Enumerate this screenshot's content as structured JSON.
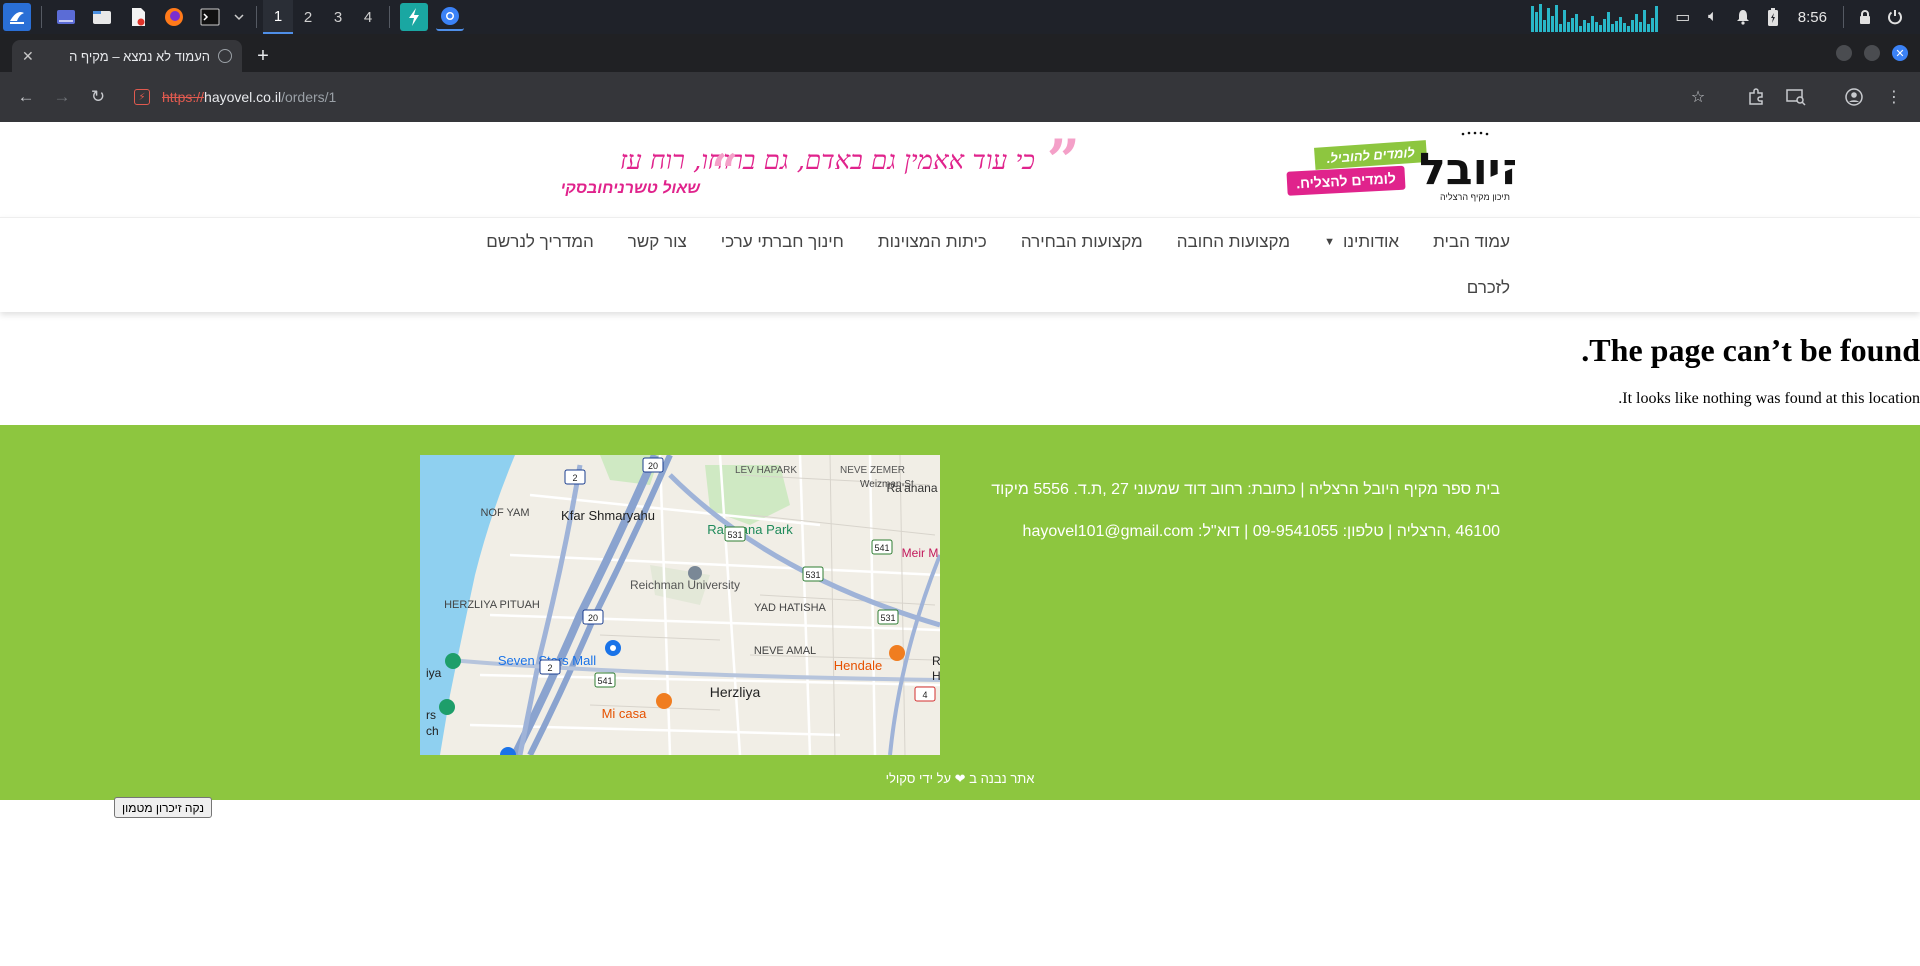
{
  "taskbar": {
    "workspaces": [
      "1",
      "2",
      "3",
      "4"
    ],
    "active_workspace": "1",
    "clock": "8:56",
    "app_icons": [
      "start-menu-icon",
      "desktop-icon",
      "file-manager-icon",
      "text-editor-icon",
      "firefox-icon",
      "terminal-icon",
      "chevron-down-icon",
      "thunder-app-icon",
      "chromium-icon"
    ],
    "tray_icons": [
      "screen-icon",
      "volume-icon",
      "bell-icon",
      "battery-icon",
      "lock-icon"
    ],
    "accent_color": "#4f8fe8"
  },
  "browser": {
    "tab_title": "העמוד לא נמצא – מקיף ה",
    "url_scheme": "https://",
    "url_host": "hayovel.co.il",
    "url_path": "/orders/1"
  },
  "site": {
    "logo_text": "היובל",
    "logo_subtitle": "תיכון מקיף הרצליה",
    "sticker_top": "לומדים להוביל.",
    "sticker_bottom": "לומדים להצליח.",
    "quote": "כי עוד אאמין גם באדם, גם ברוחו, רוח עז",
    "quote_author": "שאול טשרניחובסקי",
    "brand_pink": "#e0238c",
    "brand_green": "#8dc63f"
  },
  "nav": {
    "row1": [
      "עמוד הבית",
      "אודותינו",
      "מקצועות החובה",
      "מקצועות הבחירה",
      "כיתות המצוינות",
      "חינוך חברתי ערכי",
      "צור קשר",
      "המדריך לנרשם"
    ],
    "row2": [
      "לזכרם"
    ]
  },
  "content": {
    "title": "The page can’t be found.",
    "text": "It looks like nothing was found at this location."
  },
  "footer": {
    "address_line": "בית ספר מקיף היובל הרצליה | כתובת: רחוב דוד שמעוני 27 ,ת.ד. 5556 מיקוד",
    "contact_line": "46100 ,הרצליה | טלפון: 09-9541055 | דוא\"ל: hayovel101@gmail.com",
    "credit": "אתר נבנה ב ❤ על ידי סקולי",
    "map": {
      "places": [
        "LEV HAPARK",
        "NEVE ZEMER",
        "Weizman St",
        "Ra'anana",
        "NOF YAM",
        "Kfar Shmaryahu",
        "Ra'anana Park",
        "Meir M",
        "Reichman University",
        "HERZLIYA PITUAH",
        "YAD HATISHA",
        "NEVE AMAL",
        "Seven Stars Mall",
        "Hendale",
        "Herzliya",
        "Mi casa",
        "iya",
        "rs",
        "ch",
        "Ra",
        "Ha"
      ],
      "road_numbers": [
        "2",
        "20",
        "531",
        "541",
        "531",
        "20",
        "2",
        "541",
        "531",
        "4"
      ]
    }
  },
  "cache_button": "נקה זיכרון מטמון"
}
